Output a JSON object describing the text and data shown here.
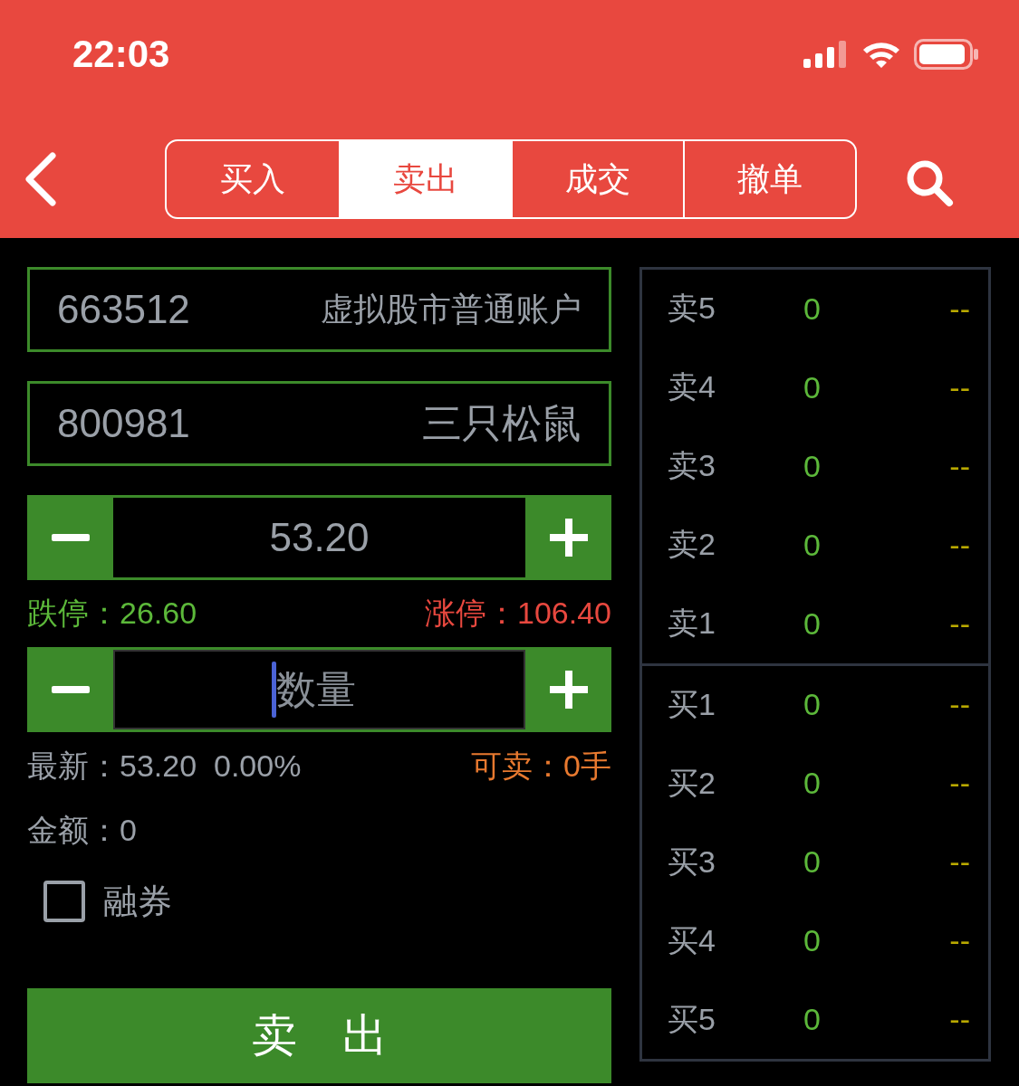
{
  "status_bar": {
    "time": "22:03"
  },
  "nav": {
    "tabs": [
      {
        "label": "买入",
        "selected": false
      },
      {
        "label": "卖出",
        "selected": true
      },
      {
        "label": "成交",
        "selected": false
      },
      {
        "label": "撤单",
        "selected": false
      }
    ]
  },
  "account": {
    "code": "663512",
    "name": "虚拟股市普通账户"
  },
  "stock": {
    "code": "800981",
    "name": "三只松鼠"
  },
  "price": {
    "value": "53.20"
  },
  "limits": {
    "down_label": "跌停：",
    "down_value": "26.60",
    "up_label": "涨停：",
    "up_value": "106.40"
  },
  "quantity": {
    "placeholder": "数量",
    "focused": true
  },
  "latest": {
    "label": "最新：",
    "price": "53.20",
    "change": "0.00%"
  },
  "sellable": {
    "label": "可卖：",
    "value": "0手"
  },
  "amount": {
    "label": "金额：",
    "value": "0"
  },
  "option": {
    "label": "融券",
    "checked": false
  },
  "submit": "卖　出",
  "order_book": {
    "asks": [
      {
        "label": "卖5",
        "volume": "0",
        "price": "--"
      },
      {
        "label": "卖4",
        "volume": "0",
        "price": "--"
      },
      {
        "label": "卖3",
        "volume": "0",
        "price": "--"
      },
      {
        "label": "卖2",
        "volume": "0",
        "price": "--"
      },
      {
        "label": "卖1",
        "volume": "0",
        "price": "--"
      }
    ],
    "bids": [
      {
        "label": "买1",
        "volume": "0",
        "price": "--"
      },
      {
        "label": "买2",
        "volume": "0",
        "price": "--"
      },
      {
        "label": "买3",
        "volume": "0",
        "price": "--"
      },
      {
        "label": "买4",
        "volume": "0",
        "price": "--"
      },
      {
        "label": "买5",
        "volume": "0",
        "price": "--"
      }
    ]
  }
}
